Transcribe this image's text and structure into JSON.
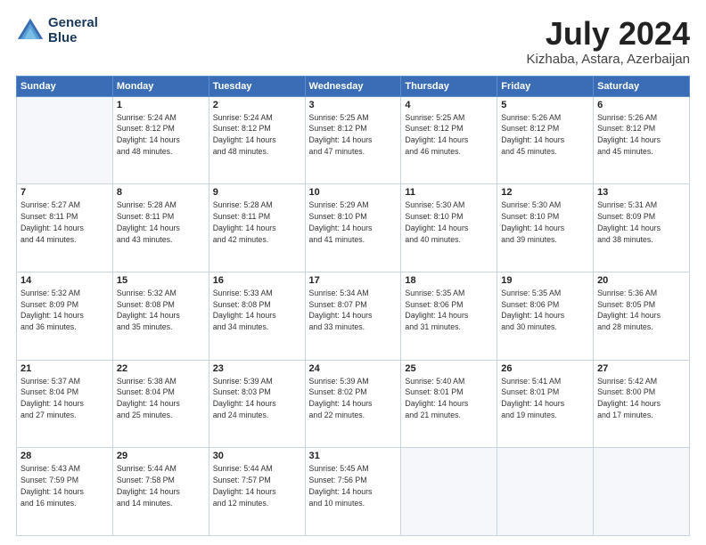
{
  "logo": {
    "line1": "General",
    "line2": "Blue"
  },
  "title": "July 2024",
  "location": "Kizhaba, Astara, Azerbaijan",
  "days_of_week": [
    "Sunday",
    "Monday",
    "Tuesday",
    "Wednesday",
    "Thursday",
    "Friday",
    "Saturday"
  ],
  "weeks": [
    [
      {
        "day": "",
        "info": ""
      },
      {
        "day": "1",
        "info": "Sunrise: 5:24 AM\nSunset: 8:12 PM\nDaylight: 14 hours\nand 48 minutes."
      },
      {
        "day": "2",
        "info": "Sunrise: 5:24 AM\nSunset: 8:12 PM\nDaylight: 14 hours\nand 48 minutes."
      },
      {
        "day": "3",
        "info": "Sunrise: 5:25 AM\nSunset: 8:12 PM\nDaylight: 14 hours\nand 47 minutes."
      },
      {
        "day": "4",
        "info": "Sunrise: 5:25 AM\nSunset: 8:12 PM\nDaylight: 14 hours\nand 46 minutes."
      },
      {
        "day": "5",
        "info": "Sunrise: 5:26 AM\nSunset: 8:12 PM\nDaylight: 14 hours\nand 45 minutes."
      },
      {
        "day": "6",
        "info": "Sunrise: 5:26 AM\nSunset: 8:12 PM\nDaylight: 14 hours\nand 45 minutes."
      }
    ],
    [
      {
        "day": "7",
        "info": "Sunrise: 5:27 AM\nSunset: 8:11 PM\nDaylight: 14 hours\nand 44 minutes."
      },
      {
        "day": "8",
        "info": "Sunrise: 5:28 AM\nSunset: 8:11 PM\nDaylight: 14 hours\nand 43 minutes."
      },
      {
        "day": "9",
        "info": "Sunrise: 5:28 AM\nSunset: 8:11 PM\nDaylight: 14 hours\nand 42 minutes."
      },
      {
        "day": "10",
        "info": "Sunrise: 5:29 AM\nSunset: 8:10 PM\nDaylight: 14 hours\nand 41 minutes."
      },
      {
        "day": "11",
        "info": "Sunrise: 5:30 AM\nSunset: 8:10 PM\nDaylight: 14 hours\nand 40 minutes."
      },
      {
        "day": "12",
        "info": "Sunrise: 5:30 AM\nSunset: 8:10 PM\nDaylight: 14 hours\nand 39 minutes."
      },
      {
        "day": "13",
        "info": "Sunrise: 5:31 AM\nSunset: 8:09 PM\nDaylight: 14 hours\nand 38 minutes."
      }
    ],
    [
      {
        "day": "14",
        "info": "Sunrise: 5:32 AM\nSunset: 8:09 PM\nDaylight: 14 hours\nand 36 minutes."
      },
      {
        "day": "15",
        "info": "Sunrise: 5:32 AM\nSunset: 8:08 PM\nDaylight: 14 hours\nand 35 minutes."
      },
      {
        "day": "16",
        "info": "Sunrise: 5:33 AM\nSunset: 8:08 PM\nDaylight: 14 hours\nand 34 minutes."
      },
      {
        "day": "17",
        "info": "Sunrise: 5:34 AM\nSunset: 8:07 PM\nDaylight: 14 hours\nand 33 minutes."
      },
      {
        "day": "18",
        "info": "Sunrise: 5:35 AM\nSunset: 8:06 PM\nDaylight: 14 hours\nand 31 minutes."
      },
      {
        "day": "19",
        "info": "Sunrise: 5:35 AM\nSunset: 8:06 PM\nDaylight: 14 hours\nand 30 minutes."
      },
      {
        "day": "20",
        "info": "Sunrise: 5:36 AM\nSunset: 8:05 PM\nDaylight: 14 hours\nand 28 minutes."
      }
    ],
    [
      {
        "day": "21",
        "info": "Sunrise: 5:37 AM\nSunset: 8:04 PM\nDaylight: 14 hours\nand 27 minutes."
      },
      {
        "day": "22",
        "info": "Sunrise: 5:38 AM\nSunset: 8:04 PM\nDaylight: 14 hours\nand 25 minutes."
      },
      {
        "day": "23",
        "info": "Sunrise: 5:39 AM\nSunset: 8:03 PM\nDaylight: 14 hours\nand 24 minutes."
      },
      {
        "day": "24",
        "info": "Sunrise: 5:39 AM\nSunset: 8:02 PM\nDaylight: 14 hours\nand 22 minutes."
      },
      {
        "day": "25",
        "info": "Sunrise: 5:40 AM\nSunset: 8:01 PM\nDaylight: 14 hours\nand 21 minutes."
      },
      {
        "day": "26",
        "info": "Sunrise: 5:41 AM\nSunset: 8:01 PM\nDaylight: 14 hours\nand 19 minutes."
      },
      {
        "day": "27",
        "info": "Sunrise: 5:42 AM\nSunset: 8:00 PM\nDaylight: 14 hours\nand 17 minutes."
      }
    ],
    [
      {
        "day": "28",
        "info": "Sunrise: 5:43 AM\nSunset: 7:59 PM\nDaylight: 14 hours\nand 16 minutes."
      },
      {
        "day": "29",
        "info": "Sunrise: 5:44 AM\nSunset: 7:58 PM\nDaylight: 14 hours\nand 14 minutes."
      },
      {
        "day": "30",
        "info": "Sunrise: 5:44 AM\nSunset: 7:57 PM\nDaylight: 14 hours\nand 12 minutes."
      },
      {
        "day": "31",
        "info": "Sunrise: 5:45 AM\nSunset: 7:56 PM\nDaylight: 14 hours\nand 10 minutes."
      },
      {
        "day": "",
        "info": ""
      },
      {
        "day": "",
        "info": ""
      },
      {
        "day": "",
        "info": ""
      }
    ]
  ]
}
